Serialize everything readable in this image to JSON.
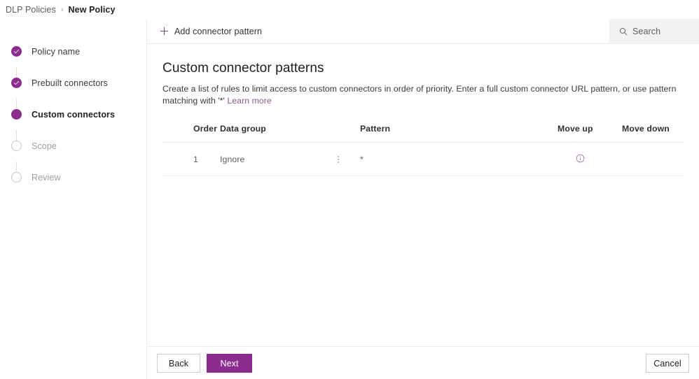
{
  "breadcrumb": {
    "root": "DLP Policies",
    "separator": "›",
    "current": "New Policy"
  },
  "sidebar": {
    "steps": [
      {
        "label": "Policy name",
        "state": "done",
        "icon": "check-icon"
      },
      {
        "label": "Prebuilt connectors",
        "state": "done",
        "icon": "check-icon"
      },
      {
        "label": "Custom connectors",
        "state": "current",
        "icon": "filled-circle-icon"
      },
      {
        "label": "Scope",
        "state": "todo",
        "icon": "empty-circle-icon"
      },
      {
        "label": "Review",
        "state": "todo",
        "icon": "empty-circle-icon"
      }
    ]
  },
  "commandbar": {
    "add_label": "Add connector pattern",
    "add_icon": "plus-icon",
    "search_placeholder": "Search",
    "search_icon": "search-icon",
    "search_value": ""
  },
  "main": {
    "title": "Custom connector patterns",
    "description_before_link": "Create a list of rules to limit access to custom connectors in order of priority. Enter a full custom connector URL pattern, or use pattern matching with '*' ",
    "link_label": "Learn more"
  },
  "table": {
    "columns": [
      "Order",
      "Data group",
      "Pattern",
      "Move up",
      "Move down"
    ],
    "rows": [
      {
        "order": "1",
        "data_group": "Ignore",
        "group_menu_icon": "more-vertical-icon",
        "pattern": "*",
        "move_up_icon": "info-circle-icon",
        "move_down": ""
      }
    ]
  },
  "footer": {
    "back_label": "Back",
    "next_label": "Next",
    "cancel_label": "Cancel"
  },
  "colors": {
    "accent_purple": "#8c2c8c",
    "link_purple": "#8c5a8c",
    "search_bg": "#f3f2f1",
    "border": "#edebe9"
  }
}
